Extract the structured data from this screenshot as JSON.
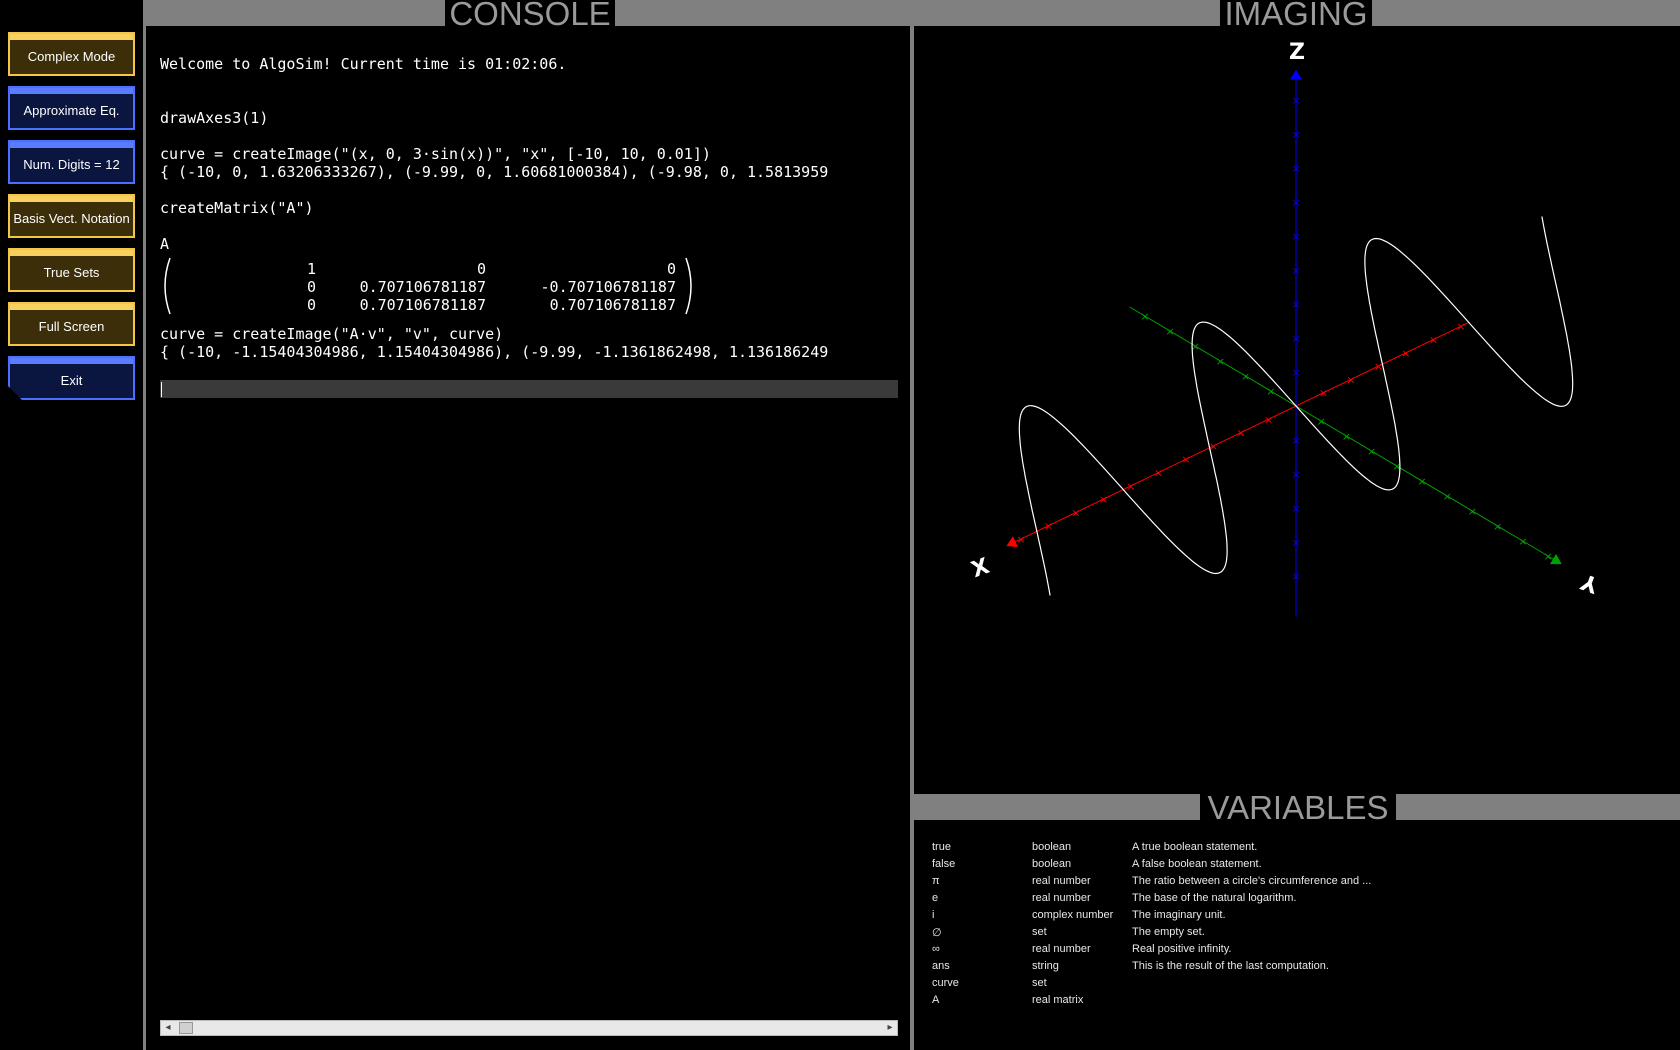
{
  "sidebar": {
    "buttons": [
      {
        "label": "Complex Mode",
        "style": "gold"
      },
      {
        "label": "Approximate Eq.",
        "style": "blue"
      },
      {
        "label": "Num. Digits = 12",
        "style": "blue"
      },
      {
        "label": "Basis Vect. Notation",
        "style": "gold"
      },
      {
        "label": "True Sets",
        "style": "gold"
      },
      {
        "label": "Full Screen",
        "style": "gold"
      },
      {
        "label": "Exit",
        "style": "blue"
      }
    ]
  },
  "panels": {
    "console_title": "CONSOLE",
    "imaging_title": "IMAGING",
    "variables_title": "VARIABLES"
  },
  "console": {
    "lines": [
      "Welcome to AlgoSim! Current time is 01:02:06.",
      "drawAxes3(1)",
      "curve = createImage(\"(x, 0, 3·sin(x))\", \"x\", [-10, 10, 0.01])",
      "{ (-10, 0, 1.63206333267), (-9.99, 0, 1.60681000384), (-9.98, 0, 1.5813959",
      "createMatrix(\"A\")",
      "A",
      "curve = createImage(\"A·v\", \"v\", curve)",
      "{ (-10, -1.15404304986, 1.15404304986), (-9.99, -1.1361862498, 1.136186249"
    ],
    "matrix": [
      [
        "1",
        "0",
        "0"
      ],
      [
        "0",
        "0.707106781187",
        "-0.707106781187"
      ],
      [
        "0",
        "0.707106781187",
        "0.707106781187"
      ]
    ],
    "input_value": "",
    "scroll_left_icon": "arrow-left",
    "scroll_right_icon": "arrow-right"
  },
  "imaging": {
    "axes": {
      "x": {
        "label": "X",
        "color": "#ff0000"
      },
      "y": {
        "label": "Y",
        "color": "#00a000"
      },
      "z": {
        "label": "Z",
        "color": "#0000ff"
      }
    },
    "curve_color": "#ffffff"
  },
  "variables": [
    {
      "name": "true",
      "type": "boolean",
      "desc": "A true boolean statement."
    },
    {
      "name": "false",
      "type": "boolean",
      "desc": "A false boolean statement."
    },
    {
      "name": "π",
      "type": "real number",
      "desc": "The ratio between a circle's circumference and ..."
    },
    {
      "name": "e",
      "type": "real number",
      "desc": "The base of the natural logarithm."
    },
    {
      "name": "i",
      "type": "complex number",
      "desc": "The imaginary unit."
    },
    {
      "name": "∅",
      "type": "set",
      "desc": "The empty set."
    },
    {
      "name": "∞",
      "type": "real number",
      "desc": "Real positive infinity."
    },
    {
      "name": "ans",
      "type": "string",
      "desc": "This is the result of the last computation."
    },
    {
      "name": "curve",
      "type": "set",
      "desc": ""
    },
    {
      "name": "A",
      "type": "real matrix",
      "desc": ""
    }
  ]
}
